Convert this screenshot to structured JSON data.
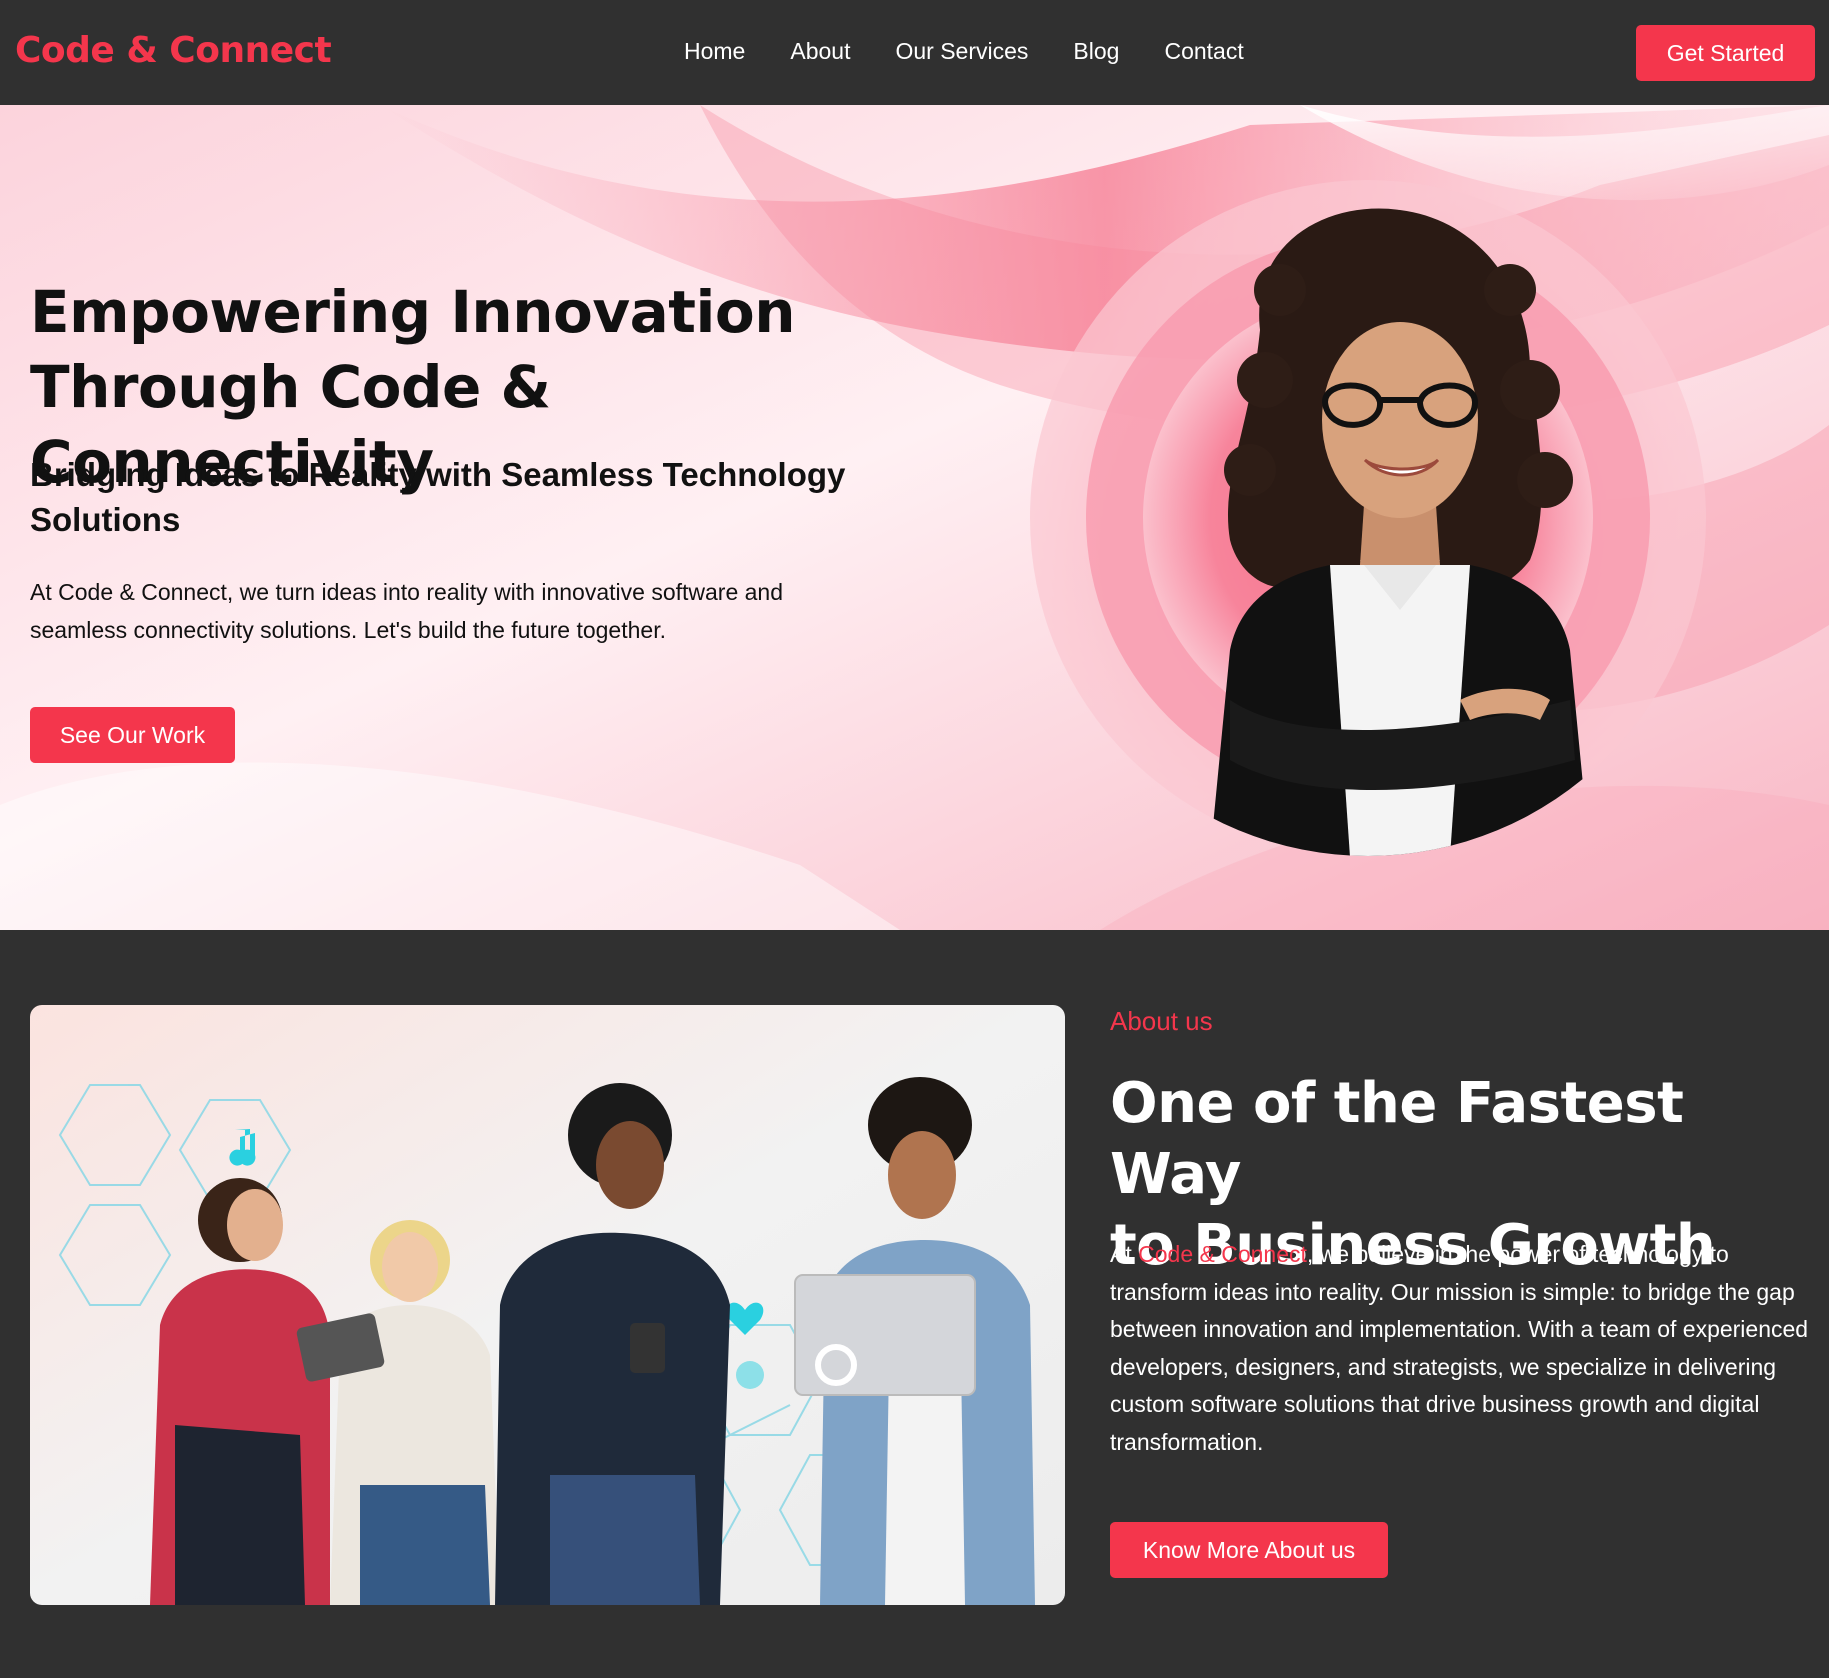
{
  "brand": {
    "name": "Code & Connect"
  },
  "nav": {
    "items": [
      {
        "label": "Home"
      },
      {
        "label": "About"
      },
      {
        "label": "Our Services"
      },
      {
        "label": "Blog"
      },
      {
        "label": "Contact"
      }
    ],
    "cta_label": "Get Started"
  },
  "hero": {
    "title_line1": "Empowering Innovation",
    "title_line2": "Through Code & Connectivity",
    "subtitle": "Bridging Ideas to Reality with Seamless Technology Solutions",
    "text": "At Code & Connect, we turn ideas into reality with innovative software and seamless connectivity solutions. Let's build the future together.",
    "button_label": "See Our Work"
  },
  "about": {
    "label": "About us",
    "title_line1": "One of the Fastest Way",
    "title_line2": "to Business Growth",
    "text_prefix": "At ",
    "text_highlight": "Code & Connect",
    "text_rest": ", we believe in the power of technology to transform ideas into reality. Our mission is simple: to bridge the gap between innovation and implementation. With a team of experienced developers, designers, and strategists, we specialize in delivering custom software solutions that drive business growth and digital transformation.",
    "button_label": "Know More About us"
  },
  "colors": {
    "accent": "#f4364c",
    "dark_bg": "#303030",
    "hero_bg": "#fde7ec"
  }
}
